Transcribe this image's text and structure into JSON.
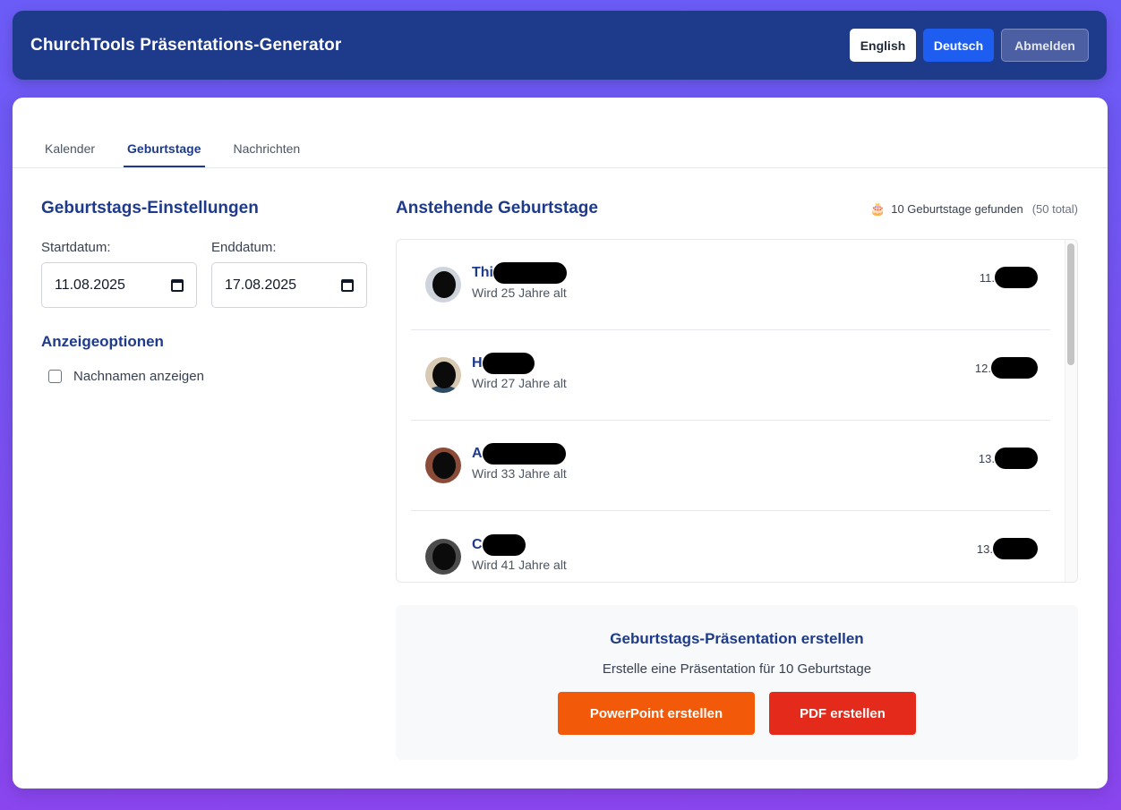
{
  "header": {
    "title": "ChurchTools Präsentations-Generator",
    "english_label": "English",
    "deutsch_label": "Deutsch",
    "logout_label": "Abmelden"
  },
  "tabs": [
    {
      "label": "Kalender"
    },
    {
      "label": "Geburtstage"
    },
    {
      "label": "Nachrichten"
    }
  ],
  "settings": {
    "title": "Geburtstags-Einstellungen",
    "start_label": "Startdatum:",
    "start_value": "11.08.2025",
    "end_label": "Enddatum:",
    "end_value": "17.08.2025",
    "options_title": "Anzeigeoptionen",
    "show_lastname_label": "Nachnamen anzeigen"
  },
  "birthdays": {
    "title": "Anstehende Geburtstage",
    "cake_icon": "🎂",
    "found_text": "10 Geburtstage gefunden",
    "total_text": "(50 total)",
    "items": [
      {
        "name": "Thi",
        "age": "Wird 25 Jahre alt",
        "date": "11."
      },
      {
        "name": "H",
        "age": "Wird 27 Jahre alt",
        "date": "12."
      },
      {
        "name": "A",
        "age": "Wird 33 Jahre alt",
        "date": "13."
      },
      {
        "name": "C",
        "age": "Wird 41 Jahre alt",
        "date": "13."
      }
    ]
  },
  "create": {
    "title": "Geburtstags-Präsentation erstellen",
    "subtitle": "Erstelle eine Präsentation für 10 Geburtstage",
    "ppt_label": "PowerPoint erstellen",
    "pdf_label": "PDF erstellen",
    "ppt_color": "#f25a0a",
    "pdf_color": "#e42a1a"
  },
  "colors": {
    "primary": "#1e3a8a",
    "accent": "#1d5ef0"
  }
}
